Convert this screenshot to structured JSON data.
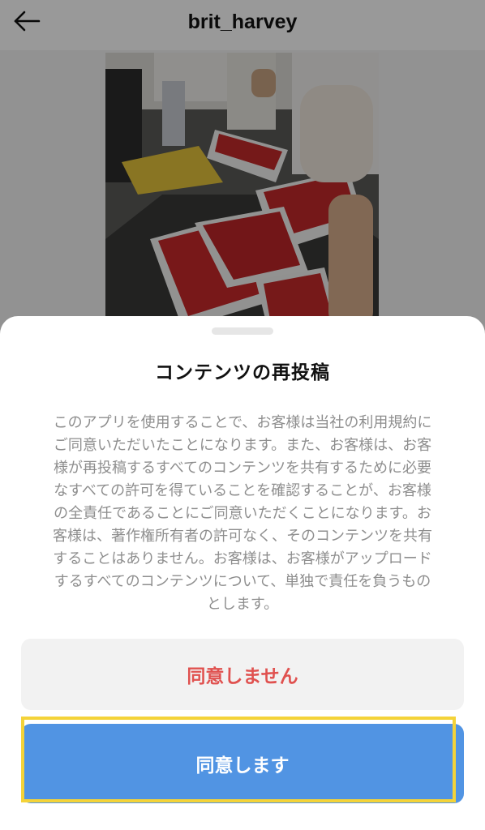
{
  "header": {
    "username": "brit_harvey",
    "back_icon": "arrow-left-icon"
  },
  "post": {
    "image": "strawberry-market-photo"
  },
  "sheet": {
    "title": "コンテンツの再投稿",
    "body_lines": [
      "このアプリを使用することで、お客様は当社の利用規約に",
      "ご同意いただいたことになります。また、お客様は、お客",
      "様が再投稿するすべてのコンテンツを共有するために必要",
      "なすべての許可を得ていることを確認することが、お客様",
      "の全責任であることにご同意いただくことになります。お",
      "客様は、著作権所有者の許可なく、そのコンテンツを共有",
      "することはありません。お客様は、お客様がアップロード",
      "するすべてのコンテンツについて、単独で責任を負うもの",
      "とします。"
    ],
    "decline_label": "同意しません",
    "agree_label": "同意します"
  },
  "colors": {
    "accent_blue": "#5194e3",
    "decline_red": "#e0514f",
    "highlight_yellow": "#f4d339"
  }
}
